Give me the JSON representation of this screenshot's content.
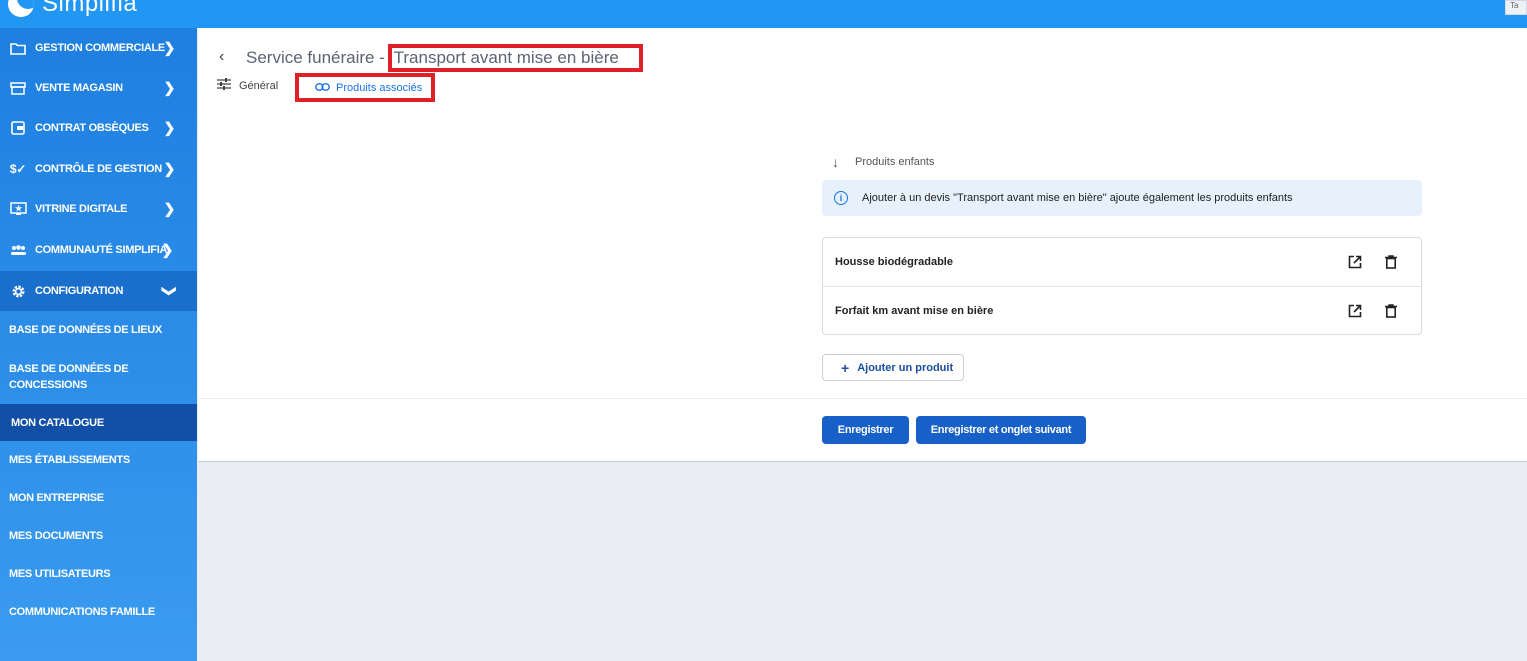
{
  "app": {
    "name": "Simplifia"
  },
  "topbar": {
    "right_button_label": "Ta"
  },
  "sidebar": {
    "items": [
      {
        "label": "GESTION COMMERCIALE",
        "icon": "folder-icon"
      },
      {
        "label": "VENTE MAGASIN",
        "icon": "storefront-icon"
      },
      {
        "label": "CONTRAT OBSÈQUES",
        "icon": "wallet-icon"
      },
      {
        "label": "CONTRÔLE DE GESTION",
        "icon": "dollar-check-icon"
      },
      {
        "label": "VITRINE DIGITALE",
        "icon": "monitor-star-icon"
      },
      {
        "label": "COMMUNAUTÉ SIMPLIFIA",
        "icon": "people-icon"
      },
      {
        "label": "CONFIGURATION",
        "icon": "gear-icon"
      }
    ],
    "sub_items": [
      {
        "label": "BASE DE DONNÉES DE LIEUX"
      },
      {
        "label": "BASE DE DONNÉES DE CONCESSIONS"
      },
      {
        "label": "MON CATALOGUE"
      },
      {
        "label": "MES ÉTABLISSEMENTS"
      },
      {
        "label": "MON ENTREPRISE"
      },
      {
        "label": "MES DOCUMENTS"
      },
      {
        "label": "MES UTILISATEURS"
      },
      {
        "label": "COMMUNICATIONS FAMILLE"
      }
    ]
  },
  "page": {
    "title_prefix": "Service funéraire - ",
    "title_product": "Transport avant mise en bière",
    "tabs": [
      {
        "label": "Général",
        "icon": "sliders-icon"
      },
      {
        "label": "Produits associés",
        "icon": "link-icon"
      }
    ],
    "children_section": {
      "heading": "Produits enfants",
      "info_text": "Ajouter à un devis \"Transport avant mise en bière\" ajoute également les produits enfants",
      "products": [
        {
          "name": "Housse biodégradable"
        },
        {
          "name": "Forfait km avant mise en bière"
        }
      ],
      "add_button_label": "Ajouter un produit"
    },
    "buttons": {
      "save": "Enregistrer",
      "save_next": "Enregistrer et onglet suivant"
    }
  },
  "colors": {
    "topbar": "#2196f3",
    "sidebar_active": "#1250a8",
    "primary_button": "#1660c7",
    "highlight_box": "#e01f26"
  }
}
